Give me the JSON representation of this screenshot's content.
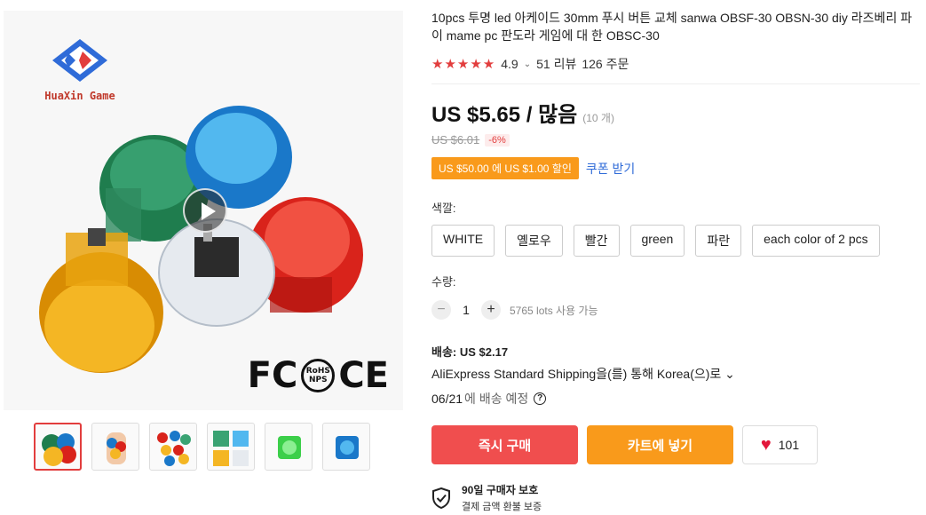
{
  "brand": {
    "name": "HuaXin Game"
  },
  "gallery": {
    "certifications": [
      "FC",
      "RoHS NPS",
      "CE"
    ],
    "thumbnails": 6
  },
  "product": {
    "title": "10pcs 투명 led 아케이드 30mm 푸시 버튼 교체 sanwa OBSF-30 OBSN-30 diy 라즈베리 파이 mame pc 판도라 게임에 대 한 OBSC-30",
    "stars": "★★★★★",
    "rating": "4.9",
    "reviews": "51 리뷰",
    "orders": "126 주문"
  },
  "price": {
    "current": "US $5.65 / 많음",
    "unit": "(10 개)",
    "original": "US $6.01",
    "discount": "-6%"
  },
  "coupon": {
    "text": "US $50.00 에 US $1.00 할인",
    "link": "쿠폰 받기"
  },
  "color": {
    "label": "색깔:",
    "options": [
      "WHITE",
      "옐로우",
      "빨간",
      "green",
      "파란",
      "each color of 2 pcs"
    ]
  },
  "quantity": {
    "label": "수량:",
    "minus": "−",
    "value": "1",
    "plus": "+",
    "available": "5765 lots 사용 가능"
  },
  "shipping": {
    "title": "배송: US $2.17",
    "method": "AliExpress Standard Shipping을(를) 통해 Korea(으)로 ⌄",
    "date": "06/21",
    "date_suffix": "에 배송 예정",
    "help": "?"
  },
  "actions": {
    "buy": "즉시 구매",
    "cart": "카트에 넣기",
    "wishlist_count": "101"
  },
  "protection": {
    "title": "90일 구매자 보호",
    "subtitle": "결제 금액 환불 보증"
  },
  "colors": {
    "accent_red": "#f04e4e",
    "accent_orange": "#f99a1b",
    "star": "#e23d3d",
    "link": "#2f6bd8"
  }
}
